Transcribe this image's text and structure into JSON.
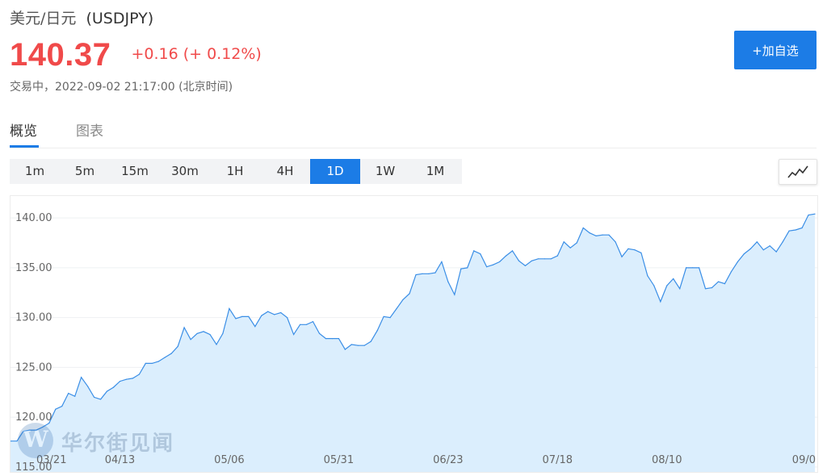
{
  "header": {
    "pair_cn": "美元/日元",
    "symbol": "(USDJPY)",
    "price": "140.37",
    "change": "+0.16 (+ 0.12%)",
    "status": "交易中，2022-09-02 21:17:00 (北京时间)",
    "add_button_label": "+加自选"
  },
  "tabs": [
    {
      "label": "概览",
      "active": true
    },
    {
      "label": "图表",
      "active": false
    }
  ],
  "intervals": [
    {
      "label": "1m"
    },
    {
      "label": "5m"
    },
    {
      "label": "15m"
    },
    {
      "label": "30m"
    },
    {
      "label": "1H"
    },
    {
      "label": "4H"
    },
    {
      "label": "1D",
      "active": true
    },
    {
      "label": "1W"
    },
    {
      "label": "1M"
    }
  ],
  "chart_type_icon": "line-chart-icon",
  "watermark": {
    "icon": "wallstreetcn-logo",
    "text": "华尔街见闻"
  },
  "colors": {
    "accent": "#1c7ce6",
    "price_up": "#f04a4a",
    "line": "#3a8ee6",
    "area_fill": "#dbeefd"
  },
  "chart_data": {
    "type": "area",
    "title": "",
    "xlabel": "",
    "ylabel": "",
    "x_tick_labels": [
      "03/21",
      "04/13",
      "05/06",
      "05/31",
      "06/23",
      "07/18",
      "08/10",
      "09/0"
    ],
    "x_tick_index": [
      0,
      17,
      34,
      51,
      68,
      85,
      102,
      119
    ],
    "y_ticks": [
      115.0,
      120.0,
      125.0,
      130.0,
      135.0,
      140.0
    ],
    "y_tick_labels": [
      "115.00",
      "120.00",
      "125.00",
      "130.00",
      "135.00",
      "140.00"
    ],
    "ylim": [
      114.5,
      142.2
    ],
    "grid": "horizontal",
    "legend": "none",
    "series": [
      {
        "values": [
          117.6,
          117.6,
          118.6,
          118.7,
          118.7,
          119.0,
          119.4,
          120.8,
          121.1,
          122.4,
          122.1,
          124.0,
          123.1,
          122.0,
          121.8,
          122.6,
          123.0,
          123.6,
          123.8,
          123.9,
          124.3,
          125.4,
          125.4,
          125.6,
          126.0,
          126.4,
          127.1,
          129.0,
          127.8,
          128.4,
          128.6,
          128.3,
          127.3,
          128.4,
          130.9,
          129.9,
          130.1,
          130.1,
          129.1,
          130.2,
          130.6,
          130.3,
          130.5,
          130.0,
          128.3,
          129.3,
          129.3,
          129.6,
          128.4,
          127.9,
          127.9,
          127.9,
          126.8,
          127.3,
          127.2,
          127.2,
          127.6,
          128.7,
          130.1,
          130.0,
          130.9,
          131.8,
          132.4,
          134.3,
          134.4,
          134.4,
          134.5,
          135.6,
          133.6,
          132.3,
          134.9,
          135.0,
          136.7,
          136.4,
          135.1,
          135.3,
          135.6,
          136.2,
          136.7,
          135.7,
          135.2,
          135.7,
          135.9,
          135.9,
          135.9,
          136.2,
          137.6,
          137.0,
          137.5,
          139.0,
          138.5,
          138.2,
          138.3,
          138.3,
          137.6,
          136.1,
          136.9,
          136.8,
          136.5,
          134.2,
          133.2,
          131.6,
          133.2,
          133.9,
          132.9,
          135.0,
          135.0,
          135.0,
          132.9,
          133.0,
          133.6,
          133.4,
          134.6,
          135.6,
          136.4,
          136.9,
          137.6,
          136.8,
          137.2,
          136.6,
          137.6,
          138.7,
          138.8,
          139.0,
          140.3,
          140.4
        ]
      }
    ]
  }
}
